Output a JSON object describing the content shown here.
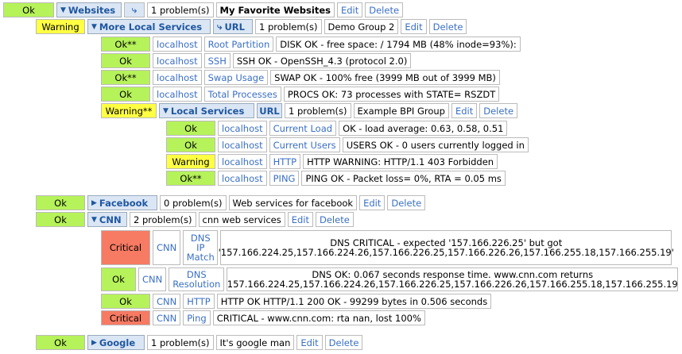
{
  "groups": {
    "websites": {
      "status": "Ok",
      "name": "Websites",
      "problems": "1 problem(s)",
      "desc": "My Favorite Websites"
    },
    "more_local": {
      "status": "Warning",
      "name": "More Local Services",
      "url": "URL",
      "problems": "1 problem(s)",
      "desc": "Demo Group 2"
    },
    "local": {
      "status": "Warning**",
      "name": "Local Services",
      "url": "URL",
      "problems": "1 problem(s)",
      "desc": "Example BPI Group"
    },
    "facebook": {
      "status": "Ok",
      "name": "Facebook",
      "problems": "0 problem(s)",
      "desc": "Web services for facebook"
    },
    "cnn": {
      "status": "Ok",
      "name": "CNN",
      "problems": "2 problem(s)",
      "desc": "cnn web services"
    },
    "google": {
      "status": "Ok",
      "name": "Google",
      "problems": "1 problem(s)",
      "desc": "It's google man"
    }
  },
  "actions": {
    "edit": "Edit",
    "delete": "Delete"
  },
  "services_more_local": [
    {
      "status": "Ok**",
      "host": "localhost",
      "service": "Root Partition",
      "output": "DISK OK - free space: / 1794 MB (48% inode=93%):"
    },
    {
      "status": "Ok",
      "host": "localhost",
      "service": "SSH",
      "output": "SSH OK - OpenSSH_4.3 (protocol 2.0)"
    },
    {
      "status": "Ok**",
      "host": "localhost",
      "service": "Swap Usage",
      "output": "SWAP OK - 100% free (3999 MB out of 3999 MB)"
    },
    {
      "status": "Ok",
      "host": "localhost",
      "service": "Total Processes",
      "output": "PROCS OK: 73 processes with STATE= RSZDT"
    }
  ],
  "services_local": [
    {
      "status": "Ok",
      "host": "localhost",
      "service": "Current Load",
      "output": "OK - load average: 0.63, 0.58, 0.51"
    },
    {
      "status": "Ok",
      "host": "localhost",
      "service": "Current Users",
      "output": "USERS OK - 0 users currently logged in"
    },
    {
      "status": "Warning",
      "host": "localhost",
      "service": "HTTP",
      "output": "HTTP WARNING: HTTP/1.1 403 Forbidden"
    },
    {
      "status": "Ok**",
      "host": "localhost",
      "service": "PING",
      "output": "PING OK - Packet loss= 0%, RTA = 0.05 ms"
    }
  ],
  "services_cnn": [
    {
      "status": "Critical",
      "host": "CNN",
      "service": "DNS IP Match",
      "output": "DNS CRITICAL - expected '157.166.226.25' but got '157.166.224.25,157.166.224.26,157.166.226.25,157.166.226.26,157.166.255.18,157.166.255.19'"
    },
    {
      "status": "Ok",
      "host": "CNN",
      "service": "DNS Resolution",
      "output": "DNS OK: 0.067 seconds response time. www.cnn.com returns 157.166.224.25,157.166.224.26,157.166.226.25,157.166.226.26,157.166.255.18,157.166.255.19"
    },
    {
      "status": "Ok",
      "host": "CNN",
      "service": "HTTP",
      "output": "HTTP OK HTTP/1.1 200 OK - 99299 bytes in 0.506 seconds"
    },
    {
      "status": "Critical",
      "host": "CNN",
      "service": "Ping",
      "output": "CRITICAL - www.cnn.com: rta nan, lost 100%"
    }
  ]
}
